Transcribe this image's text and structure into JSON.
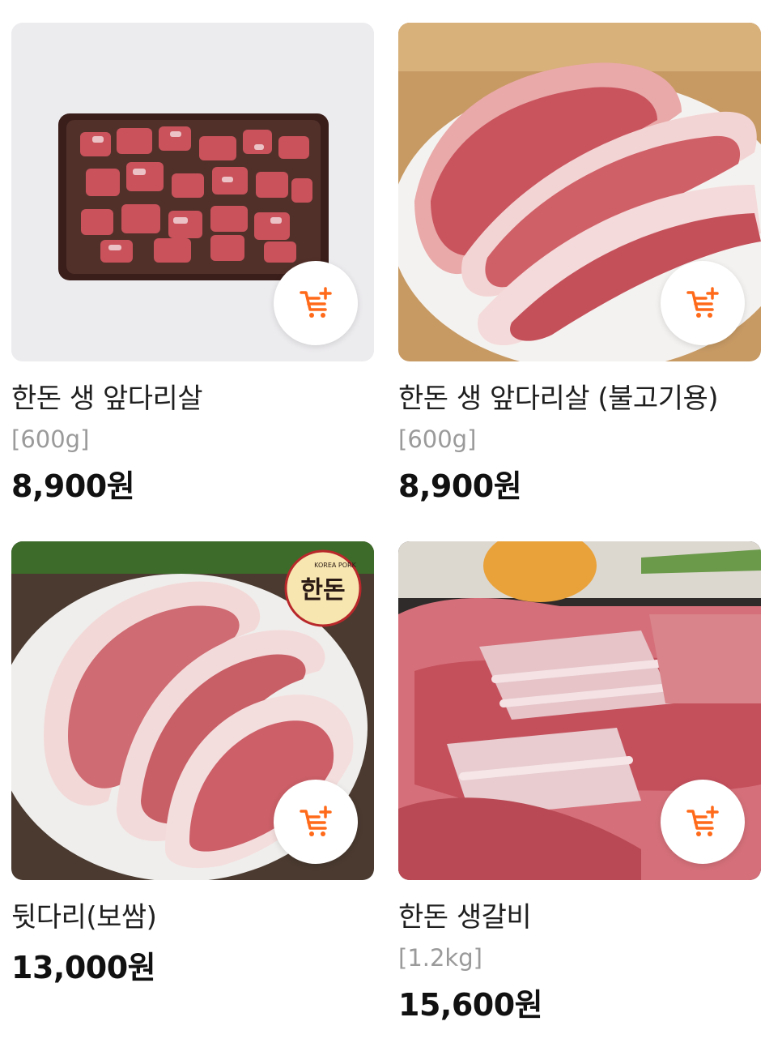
{
  "colors": {
    "accent": "#ff6a1a",
    "text": "#1f1f1f",
    "muted": "#9a9a9a"
  },
  "products": [
    {
      "name": "한돈 생 앞다리살",
      "weight": "[600g]",
      "price": "8,900원",
      "image": "diced-pork-tray",
      "cart_icon": "cart-plus-icon"
    },
    {
      "name": "한돈 생 앞다리살 (불고기용)",
      "weight": "[600g]",
      "price": "8,900원",
      "image": "pork-shoulder-slabs",
      "cart_icon": "cart-plus-icon"
    },
    {
      "name": "뒷다리(보쌈)",
      "weight": "",
      "price": "13,000원",
      "image": "pork-hind-leg-plate",
      "logo_text": [
        "한돈",
        "KOREA PORK"
      ],
      "cart_icon": "cart-plus-icon"
    },
    {
      "name": "한돈 생갈비",
      "weight": "[1.2kg]",
      "price": "15,600원",
      "image": "pork-ribs",
      "cart_icon": "cart-plus-icon"
    }
  ]
}
